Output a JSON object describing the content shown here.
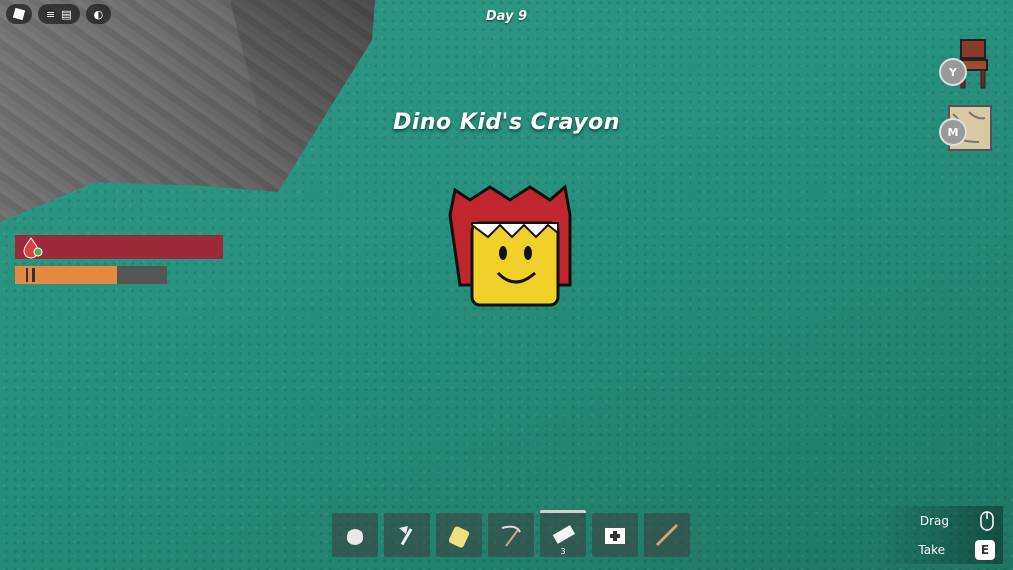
{
  "hud": {
    "day_label": "Day 9",
    "item_name": "Dino Kid's Crayon",
    "health_fraction": 1.0,
    "hunger_fraction": 0.67
  },
  "side_buttons": [
    {
      "key": "Y",
      "icon": "chair-icon"
    },
    {
      "key": "M",
      "icon": "map-icon"
    }
  ],
  "topbar": {
    "icons": [
      "roblox-icon",
      "menu-icon",
      "chat-icon",
      "record-icon"
    ]
  },
  "hotbar": {
    "slots": [
      {
        "icon": "sack-icon",
        "count": ""
      },
      {
        "icon": "axe-icon",
        "count": ""
      },
      {
        "icon": "jar-icon",
        "count": ""
      },
      {
        "icon": "scythe-icon",
        "count": ""
      },
      {
        "icon": "bandage-icon",
        "count": "3"
      },
      {
        "icon": "medkit-icon",
        "count": ""
      },
      {
        "icon": "rifle-icon",
        "count": ""
      }
    ]
  },
  "prompts": {
    "drag_label": "Drag",
    "take_label": "Take",
    "take_key": "E"
  },
  "colors": {
    "health": "#9b2a3b",
    "hunger": "#e58a45",
    "grass": "#2a927e"
  }
}
